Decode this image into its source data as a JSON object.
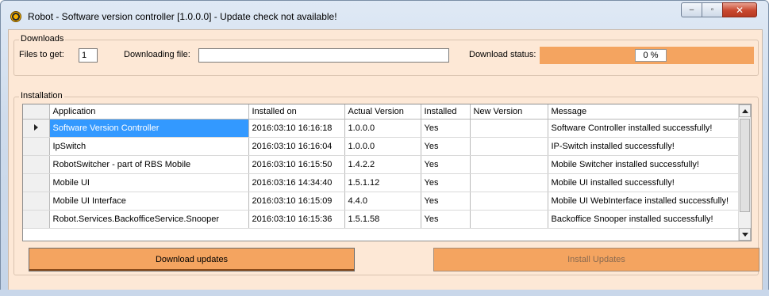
{
  "window": {
    "title": "Robot - Software version controller [1.0.0.0] - Update check not available!",
    "controls": {
      "minimize": "–",
      "maximize": "▫",
      "close": "✕"
    }
  },
  "downloads": {
    "legend": "Downloads",
    "files_to_get_label": "Files to get:",
    "files_to_get_value": "1",
    "downloading_file_label": "Downloading file:",
    "downloading_file_value": "",
    "download_status_label": "Download status:",
    "download_status_value": "0 %",
    "download_progress": 0
  },
  "installation": {
    "legend": "Installation",
    "columns": [
      "Application",
      "Installed on",
      "Actual Version",
      "Installed",
      "New Version",
      "Message"
    ],
    "rows": [
      {
        "application": "Software Version Controller",
        "installed_on": "2016:03:10 16:16:18",
        "actual_version": "1.0.0.0",
        "installed": "Yes",
        "new_version": "",
        "message": "Software Controller installed successfully!"
      },
      {
        "application": "IpSwitch",
        "installed_on": "2016:03:10 16:16:04",
        "actual_version": "1.0.0.0",
        "installed": "Yes",
        "new_version": "",
        "message": "IP-Switch installed successfully!"
      },
      {
        "application": "RobotSwitcher - part of RBS Mobile",
        "installed_on": "2016:03:10 16:15:50",
        "actual_version": "1.4.2.2",
        "installed": "Yes",
        "new_version": "",
        "message": "Mobile Switcher installed successfully!"
      },
      {
        "application": "Mobile UI",
        "installed_on": "2016:03:16 14:34:40",
        "actual_version": "1.5.1.12",
        "installed": "Yes",
        "new_version": "",
        "message": "Mobile UI installed successfully!"
      },
      {
        "application": "Mobile UI Interface",
        "installed_on": "2016:03:10 16:15:09",
        "actual_version": "4.4.0",
        "installed": "Yes",
        "new_version": "",
        "message": "Mobile UI WebInterface installed successfully!"
      },
      {
        "application": "Robot.Services.BackofficeService.Snooper",
        "installed_on": "2016:03:10 16:15:36",
        "actual_version": "1.5.1.58",
        "installed": "Yes",
        "new_version": "",
        "message": "Backoffice Snooper installed successfully!"
      }
    ],
    "selected_row": 0
  },
  "buttons": {
    "download_updates": "Download updates",
    "install_updates": "Install Updates"
  },
  "colors": {
    "accent": "#f4a460",
    "panel": "#fde8d6",
    "selection": "#3399ff"
  }
}
